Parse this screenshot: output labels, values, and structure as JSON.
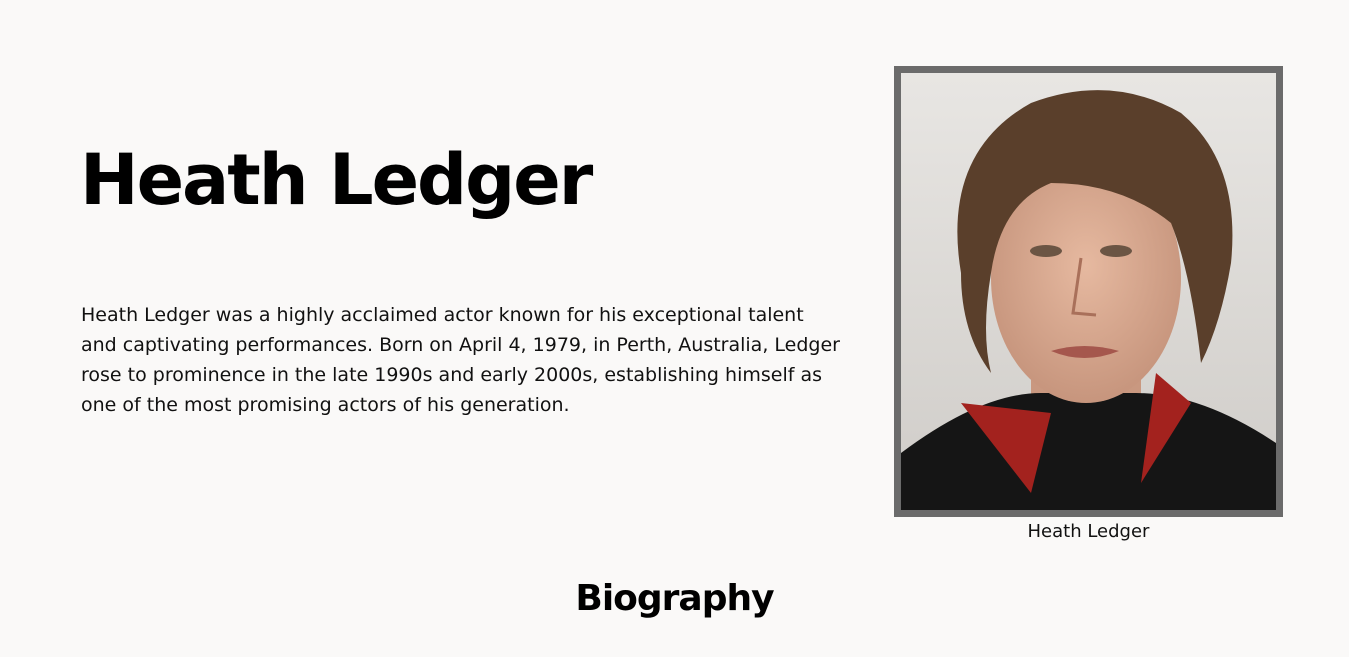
{
  "header": {
    "title": "Heath Ledger"
  },
  "intro": {
    "text": "Heath Ledger was a highly acclaimed actor known for his exceptional talent and captivating performances. Born on April 4, 1979, in Perth, Australia, Ledger rose to prominence in the late 1990s and early 2000s, establishing himself as one of the most promising actors of his generation."
  },
  "photo": {
    "caption": "Heath Ledger",
    "frame_color": "#6b6b6b"
  },
  "sections": {
    "biography_heading": "Biography"
  },
  "colors": {
    "background": "#faf9f8",
    "text": "#111111"
  }
}
